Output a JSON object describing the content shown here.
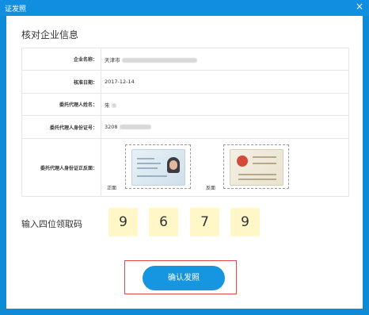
{
  "dialog": {
    "title": "证发照",
    "close": "×"
  },
  "heading": "核对企业信息",
  "info": {
    "company_name": {
      "label": "企业名称：",
      "value": "天津市"
    },
    "approval_date": {
      "label": "核准日期：",
      "value": "2017-12-14"
    },
    "agent_name": {
      "label": "委托代理人姓名：",
      "value": "朱"
    },
    "agent_id": {
      "label": "委托代理人身份证号：",
      "value": "3208"
    },
    "agent_id_card": {
      "label": "委托代理人身份证正反面：",
      "front": "正面",
      "back": "反面"
    }
  },
  "pickup": {
    "label": "输入四位领取码",
    "digits": [
      "9",
      "6",
      "7",
      "9"
    ]
  },
  "confirm_button": "确认发照",
  "colors": {
    "titlebar": "#118ee0",
    "button": "#1696e0",
    "code_bg": "#fff7c8",
    "highlight": "#e04848"
  }
}
